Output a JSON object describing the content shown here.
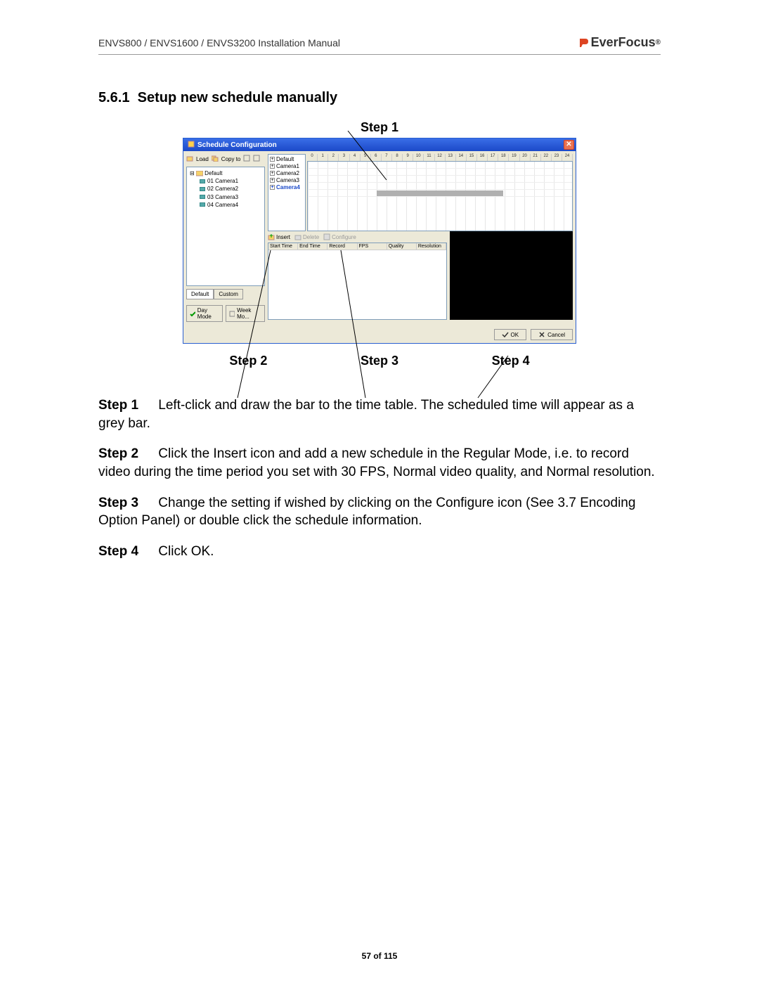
{
  "header": {
    "doc_title": "ENVS800 / ENVS1600 / ENVS3200 Installation Manual",
    "brand": "EverFocus"
  },
  "section": {
    "number": "5.6.1",
    "title": "Setup new schedule manually"
  },
  "callouts": {
    "top": "Step 1",
    "bottom": [
      "Step 2",
      "Step 3",
      "Step 4"
    ]
  },
  "window": {
    "title": "Schedule Configuration",
    "toolbar": {
      "load": "Load",
      "copyto": "Copy to"
    },
    "tree": {
      "root": "Default",
      "items": [
        "01 Camera1",
        "02 Camera2",
        "03 Camera3",
        "04 Camera4"
      ]
    },
    "tabs": {
      "default": "Default",
      "custom": "Custom"
    },
    "mode": {
      "day": "Day Mode",
      "week": "Week Mo..."
    },
    "camlist": [
      "Default",
      "Camera1",
      "Camera2",
      "Camera3",
      "Camera4"
    ],
    "selected_cam_index": 4,
    "hours": [
      "0",
      "1",
      "2",
      "3",
      "4",
      "5",
      "6",
      "7",
      "8",
      "9",
      "10",
      "11",
      "12",
      "13",
      "14",
      "15",
      "16",
      "17",
      "18",
      "19",
      "20",
      "21",
      "22",
      "23",
      "24"
    ],
    "mid_toolbar": {
      "insert": "Insert",
      "delete": "Delete",
      "configure": "Configure"
    },
    "sched_cols": [
      "Start Time",
      "End Time",
      "Record",
      "FPS",
      "Quality",
      "Resolution"
    ],
    "footer": {
      "ok": "OK",
      "cancel": "Cancel"
    }
  },
  "steps": [
    {
      "label": "Step 1",
      "text": "Left-click and draw the bar to the time table. The scheduled time will appear as a grey bar."
    },
    {
      "label": "Step 2",
      "text": "Click the Insert icon and add a new schedule in the Regular Mode, i.e. to record video during the time period you set with 30 FPS, Normal video quality, and Normal resolution."
    },
    {
      "label": "Step 3",
      "text": "Change the setting if wished by clicking on the Configure icon (See 3.7 Encoding Option Panel) or double click the schedule information."
    },
    {
      "label": "Step 4",
      "text": "Click OK."
    }
  ],
  "page_number": "57 of 115"
}
